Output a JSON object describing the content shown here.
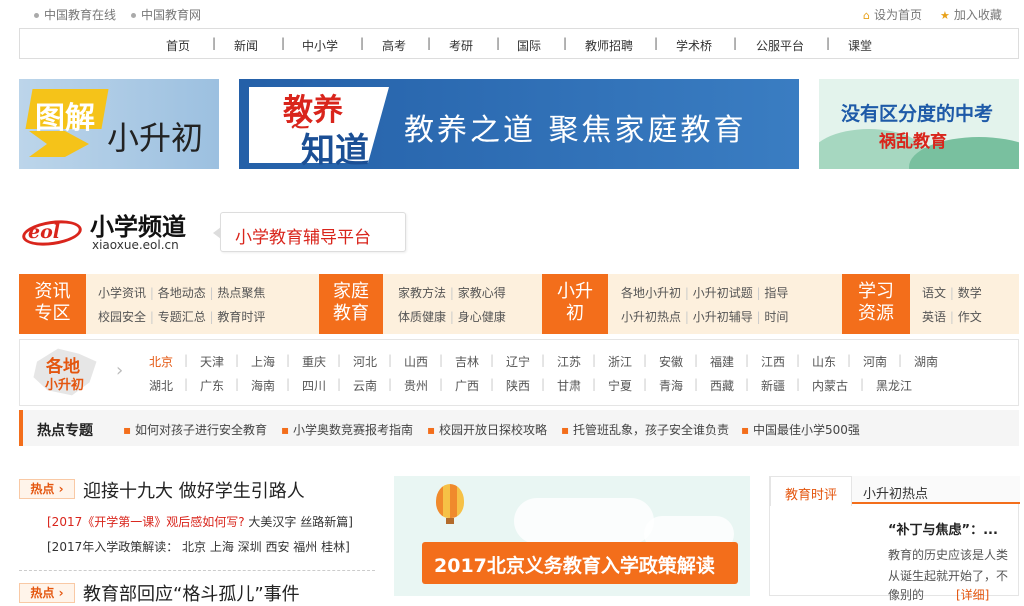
{
  "topbar": {
    "left_links": [
      "中国教育在线",
      "中国教育网"
    ],
    "set_home": "设为首页",
    "favorite": "加入收藏"
  },
  "nav": {
    "items": [
      "首页",
      "新闻",
      "中小学",
      "高考",
      "考研",
      "国际",
      "教师招聘",
      "学术桥",
      "公服平台",
      "课堂"
    ],
    "sep": "|"
  },
  "banners": {
    "left": {
      "line1": "图解",
      "line2": "小升初"
    },
    "middle": {
      "logo_top": "教养",
      "logo_bottom": "知道",
      "logo_mid": "之",
      "slogan": "教养之道 聚焦家庭教育"
    },
    "right": {
      "line1": "没有区分度的中考",
      "line2": "祸乱教育"
    }
  },
  "logo": {
    "mark": "eol",
    "title": "小学频道",
    "domain": "xiaoxue.eol.cn",
    "tagline": "小学教育辅导平台"
  },
  "channels": [
    {
      "title_l1": "资讯",
      "title_l2": "专区",
      "row1": [
        "小学资讯",
        "各地动态",
        "热点聚焦"
      ],
      "row2": [
        "校园安全",
        "专题汇总",
        "教育时评"
      ]
    },
    {
      "title_l1": "家庭",
      "title_l2": "教育",
      "row1": [
        "家教方法",
        "家教心得"
      ],
      "row2": [
        "体质健康",
        "身心健康"
      ]
    },
    {
      "title_l1": "小升",
      "title_l2": "初",
      "row1": [
        "各地小升初",
        "小升初试题",
        "指导"
      ],
      "row2": [
        "小升初热点",
        "小升初辅导",
        "时间"
      ]
    },
    {
      "title_l1": "学习",
      "title_l2": "资源",
      "row1": [
        "语文",
        "数学"
      ],
      "row2": [
        "英语",
        "作文"
      ]
    }
  ],
  "regions": {
    "badge_l1": "各地",
    "badge_l2": "小升初",
    "row1": [
      "北京",
      "天津",
      "上海",
      "重庆",
      "河北",
      "山西",
      "吉林",
      "辽宁",
      "江苏",
      "浙江",
      "安徽",
      "福建",
      "江西",
      "山东",
      "河南",
      "湖南"
    ],
    "row2": [
      "湖北",
      "广东",
      "海南",
      "四川",
      "云南",
      "贵州",
      "广西",
      "陕西",
      "甘肃",
      "宁夏",
      "青海",
      "西藏",
      "新疆",
      "内蒙古",
      "黑龙江"
    ]
  },
  "hot_topics": {
    "label": "热点专题",
    "items": [
      "如何对孩子进行安全教育",
      "小学奥数竞赛报考指南",
      "校园开放日探校攻略",
      "托管班乱象，孩子安全谁负责",
      "中国最佳小学500强"
    ]
  },
  "news": {
    "tag": "热点",
    "headline1": "迎接十九大 做好学生引路人",
    "sub1": {
      "red": "[2017《开学第一课》观后感如何写?",
      "dark": "大美汉字 丝路新篇]"
    },
    "sub2": "[2017年入学政策解读： 北京 上海 深圳 西安 福州 桂林]",
    "headline2": "教育部回应“格斗孤儿”事件"
  },
  "feature": {
    "title": "2017北京义务教育入学政策解读"
  },
  "sidebar": {
    "tabs": [
      "教育时评",
      "小升初热点"
    ],
    "article_title": "“补丁与焦虑”：...",
    "article_text1": "教育的历史应该是人类",
    "article_text2": "从诞生起就开始了，不",
    "article_text3": "像别的",
    "more": "[详细]"
  },
  "colors": {
    "accent": "#f36e1b",
    "red": "#d9251c"
  }
}
